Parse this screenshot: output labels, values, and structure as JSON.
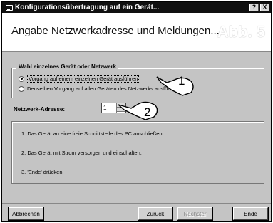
{
  "window": {
    "title": "Konfigurationsübertragung auf ein Gerät..."
  },
  "titlebar_buttons": {
    "help": "?",
    "close": "X"
  },
  "header": {
    "title": "Angabe Netzwerkadresse und Meldungen...",
    "badge": "Abb. 5"
  },
  "group": {
    "legend": "Wahl einzelnes Gerät oder Netzwerk",
    "options": [
      {
        "label": "Vorgang auf einem einzelnen Gerät ausführen",
        "selected": true
      },
      {
        "label": "Denselben Vorgang auf allen Geräten des Netzwerks ausführen",
        "selected": false
      }
    ]
  },
  "network": {
    "label": "Netzwerk-Adresse:",
    "value": "1"
  },
  "steps": [
    "1.  Das Gerät an eine freie Schnittstelle des PC anschließen.",
    "2.  Das Gerät mit Strom versorgen und einschalten.",
    "3.  'Ende' drücken"
  ],
  "buttons": {
    "cancel": "Abbrechen",
    "back": "Zurück",
    "next": "Nächster",
    "finish": "Ende"
  },
  "callouts": {
    "one": "1",
    "two": "2"
  },
  "icons": {
    "title": "window-icon"
  }
}
